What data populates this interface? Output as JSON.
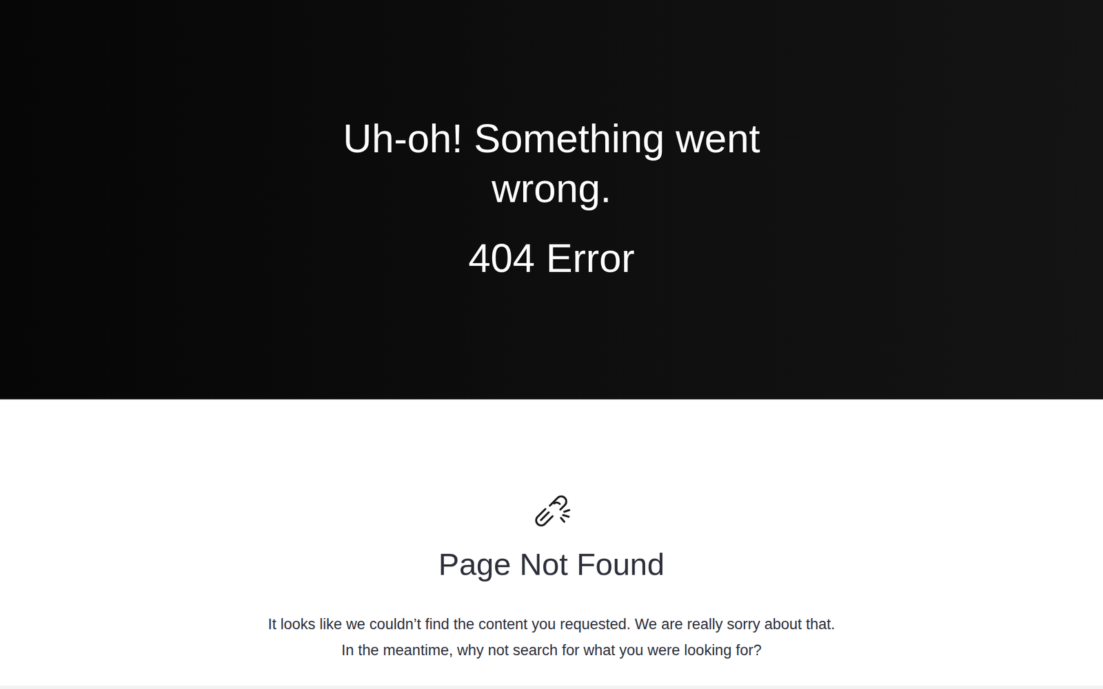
{
  "hero": {
    "title": "Uh-oh! Something went wrong.",
    "code": "404 Error"
  },
  "content": {
    "heading": "Page Not Found",
    "lines": [
      "It looks like we couldn’t find the content you requested. We are really sorry about that.",
      "In the meantime, why not search for what you were looking for?"
    ]
  }
}
